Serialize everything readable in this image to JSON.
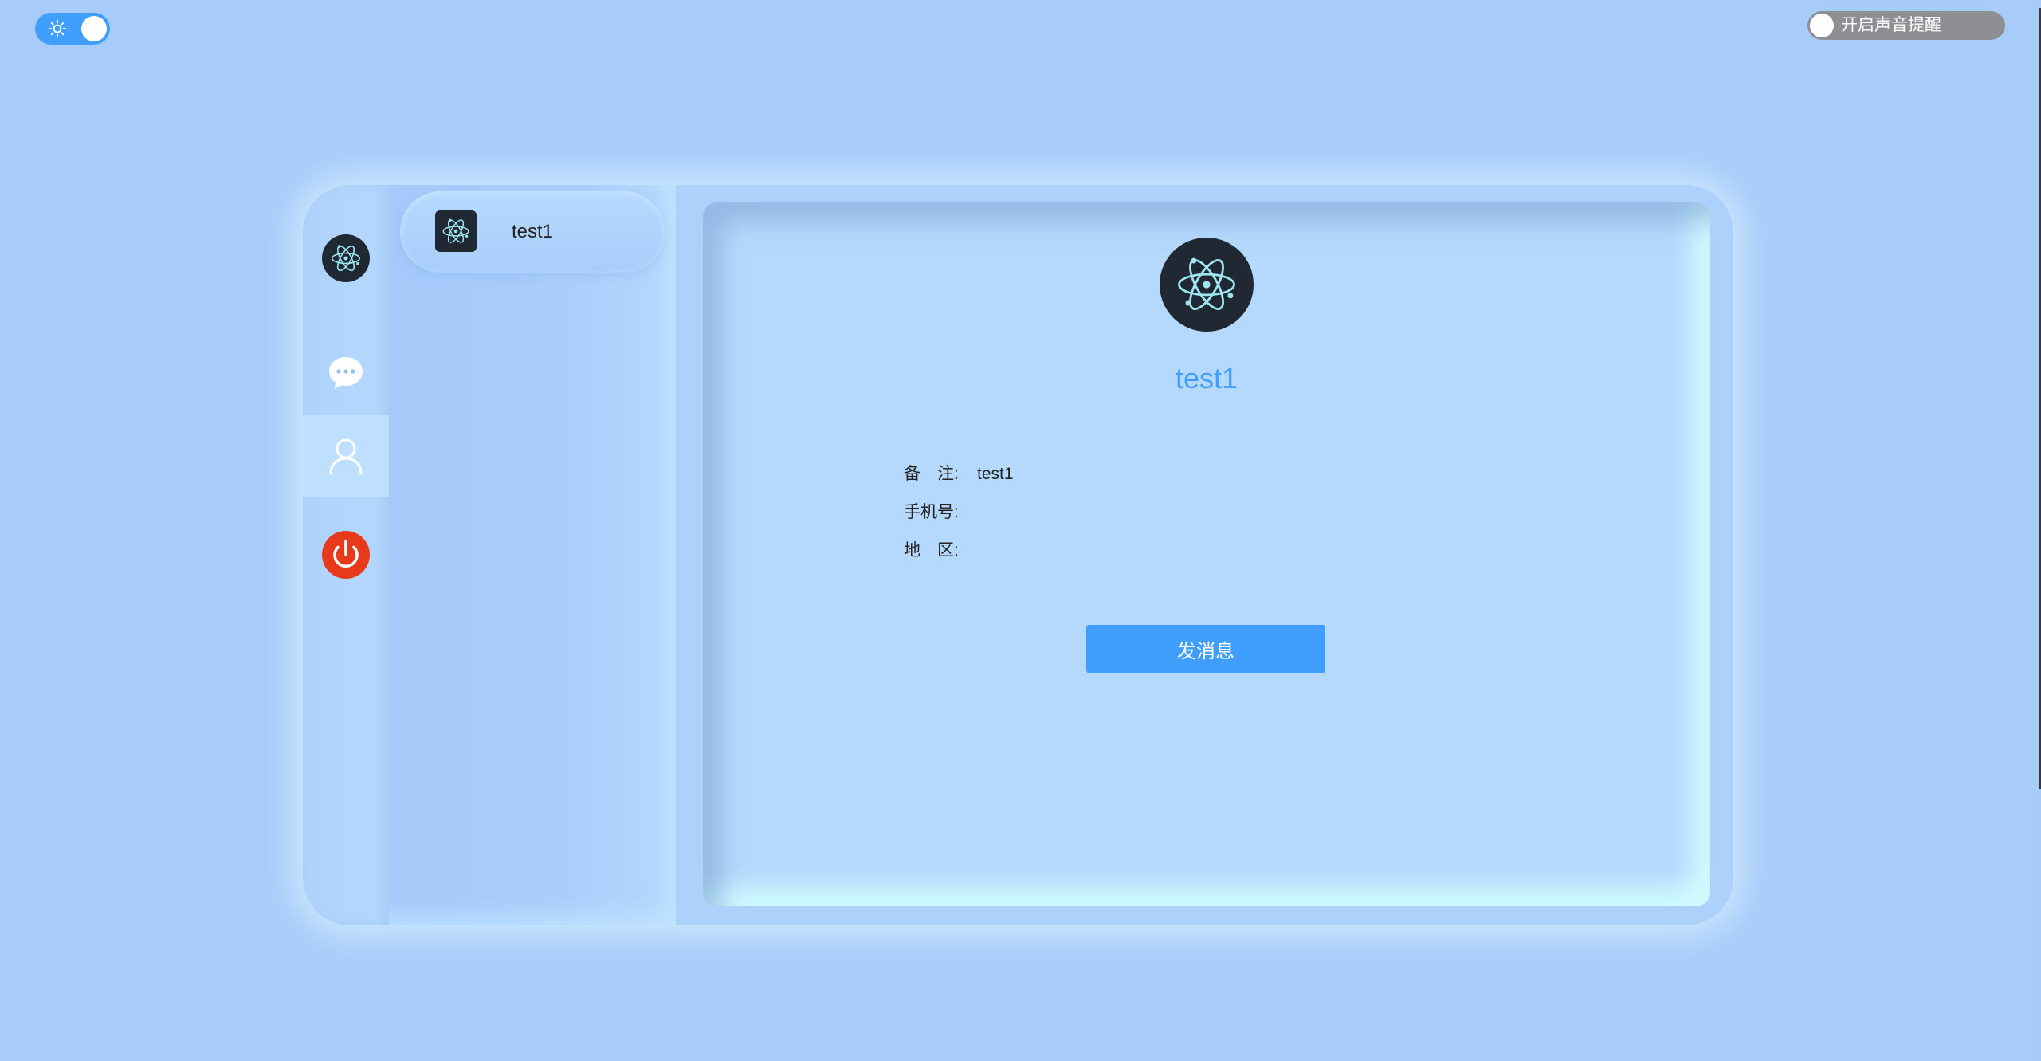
{
  "top": {
    "theme_toggle_state": "on",
    "sound_toggle_label": "开启声音提醒",
    "sound_toggle_state": "off"
  },
  "nav": {
    "items": [
      {
        "name": "profile-avatar",
        "icon": "electron-logo-icon"
      },
      {
        "name": "chat",
        "icon": "chat-bubble-icon"
      },
      {
        "name": "contacts",
        "icon": "user-icon",
        "active": true
      },
      {
        "name": "logout",
        "icon": "power-icon"
      }
    ]
  },
  "contacts": [
    {
      "name": "test1",
      "icon": "electron-logo-icon",
      "selected": true
    }
  ],
  "detail": {
    "name": "test1",
    "remark_label": "备　注:",
    "remark_value": "test1",
    "phone_label": "手机号:",
    "phone_value": "",
    "region_label": "地　区:",
    "region_value": "",
    "send_button": "发消息"
  },
  "colors": {
    "background": "#a8ccfa",
    "accent": "#409eff",
    "danger": "#e8391b",
    "avatar_bg": "#1f2833",
    "toggle_off": "#8d8f93"
  }
}
